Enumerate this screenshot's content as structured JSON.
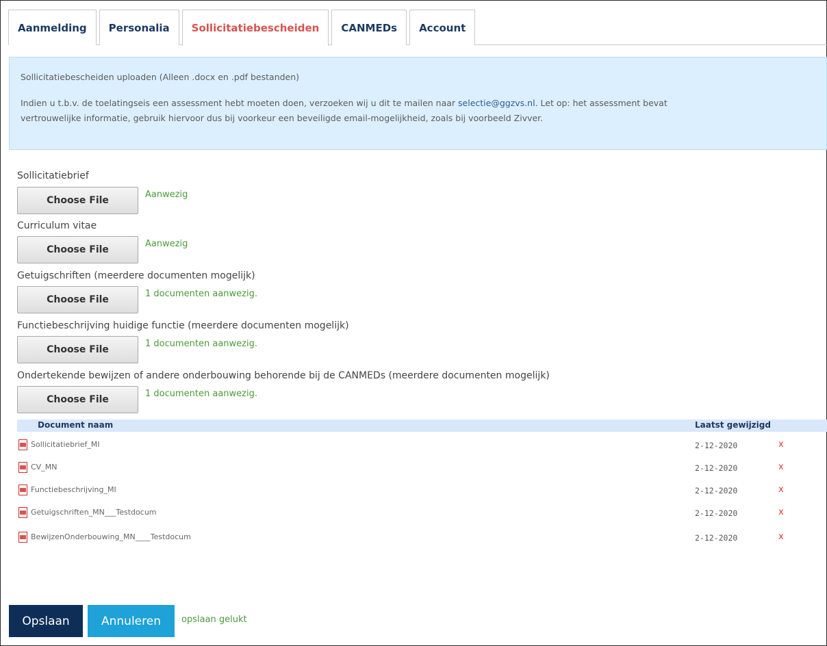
{
  "tabs": [
    {
      "label": "Aanmelding"
    },
    {
      "label": "Personalia"
    },
    {
      "label": "Sollicitatiebescheiden"
    },
    {
      "label": "CANMEDs"
    },
    {
      "label": "Account"
    }
  ],
  "active_tab": "Sollicitatiebescheiden",
  "info": {
    "line1": "Sollicitatiebescheiden uploaden (Alleen .docx en .pdf bestanden)",
    "line2_pre": "Indien u t.b.v. de toelatingseis een assessment hebt moeten doen, verzoeken wij u dit te mailen naar ",
    "email": "selectie@ggzvs.nl",
    "line2_post": ". Let op: het assessment bevat",
    "line3": "vertrouwelijke informatie, gebruik hiervoor dus bij voorkeur een beveiligde email-mogelijkheid, zoals bij voorbeeld Zivver."
  },
  "uploads": [
    {
      "label": "Sollicitatiebrief",
      "button": "Choose File",
      "status": "Aanwezig"
    },
    {
      "label": "Curriculum vitae",
      "button": "Choose File",
      "status": "Aanwezig"
    },
    {
      "label": "Getuigschriften (meerdere documenten mogelijk)",
      "button": "Choose File",
      "status": "1 documenten aanwezig."
    },
    {
      "label": "Functiebeschrijving huidige functie (meerdere documenten mogelijk)",
      "button": "Choose File",
      "status": "1 documenten aanwezig."
    },
    {
      "label": "Ondertekende bewijzen of andere onderbouwing behorende bij de CANMEDs (meerdere documenten mogelijk)",
      "button": "Choose File",
      "status": "1 documenten aanwezig."
    }
  ],
  "table": {
    "col_name": "Document naam",
    "col_date": "Laatst gewijzigd",
    "rows": [
      {
        "name": "Sollicitatiebrief_MI",
        "date": "2-12-2020",
        "delete": "x"
      },
      {
        "name": "CV_MN",
        "date": "2-12-2020",
        "delete": "x"
      },
      {
        "name": "Functiebeschrijving_MI",
        "date": "2-12-2020",
        "delete": "x"
      },
      {
        "name": "Getuigschriften_MN___Testdocum",
        "date": "2-12-2020",
        "delete": "x"
      },
      {
        "name": "BewijzenOnderbouwing_MN____Testdocum",
        "date": "2-12-2020",
        "delete": "x"
      }
    ]
  },
  "actions": {
    "save": "Opslaan",
    "cancel": "Annuleren",
    "saved_message": "opslaan gelukt"
  },
  "colors": {
    "active_tab": "#d9534f",
    "tab_text": "#1b3a5f",
    "info_bg": "#dcefff",
    "status_green": "#4a9a3a",
    "save_btn": "#0f2e57",
    "cancel_btn": "#1ea2d8",
    "delete_red": "#e23b3b"
  },
  "icons": {
    "document": "pdf-icon",
    "delete": "delete-icon"
  }
}
